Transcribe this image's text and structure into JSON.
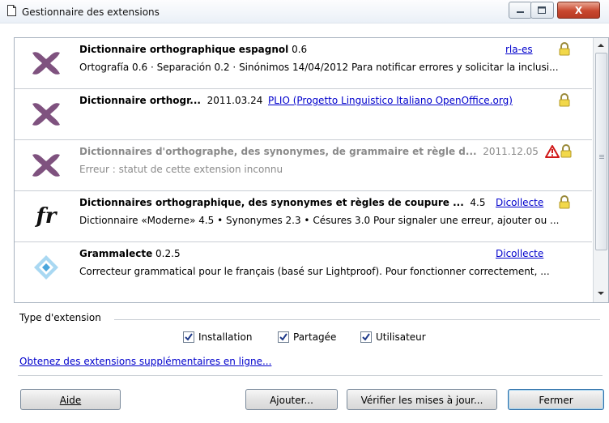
{
  "window": {
    "title": "Gestionnaire des extensions",
    "close_glyph": "X"
  },
  "extensions": [
    {
      "name": "Dictionnaire orthographique espagnol",
      "version": "0.6",
      "link": "rla-es",
      "description": "Ortografía 0.6 · Separación 0.2 · Sinónimos 14/04/2012  Para notificar errores y solicitar la inclusi...",
      "icon": "puzzle-icon",
      "locked": true
    },
    {
      "name": "Dictionnaire orthogr...",
      "version": "2011.03.24",
      "link": "PLIO (Progetto Linguistico Italiano OpenOffice.org)",
      "description": "",
      "icon": "puzzle-icon",
      "locked": true
    },
    {
      "name": "Dictionnaires d'orthographe, des synonymes, de grammaire et règle d...",
      "version": "2011.12.05",
      "link": "",
      "description": "Erreur : statut de cette extension inconnu",
      "icon": "puzzle-icon",
      "locked": true,
      "warning": true
    },
    {
      "name": "Dictionnaires orthographique, des synonymes et règles de coupure ...",
      "version": "4.5",
      "link": "Dicollecte",
      "description": "Dictionnaire «Moderne» 4.5 • Synonymes 2.3 • Césures 3.0   Pour signaler une erreur, ajouter ou ...",
      "icon": "fr",
      "locked": true
    },
    {
      "name": "Grammalecte",
      "version": "0.2.5",
      "link": "Dicollecte",
      "description": "Correcteur grammatical pour le français (basé sur Lightproof). Pour fonctionner correctement, ...",
      "icon": "grammalecte-icon",
      "locked": false
    }
  ],
  "filter": {
    "label": "Type d'extension",
    "options": [
      {
        "label": "Installation",
        "checked": true
      },
      {
        "label": "Partagée",
        "checked": true
      },
      {
        "label": "Utilisateur",
        "checked": true
      }
    ]
  },
  "more_link": "Obtenez des extensions supplémentaires en ligne...",
  "buttons": {
    "help": "Aide",
    "add": "Ajouter...",
    "check_updates": "Vérifier les mises à jour...",
    "close": "Fermer"
  }
}
